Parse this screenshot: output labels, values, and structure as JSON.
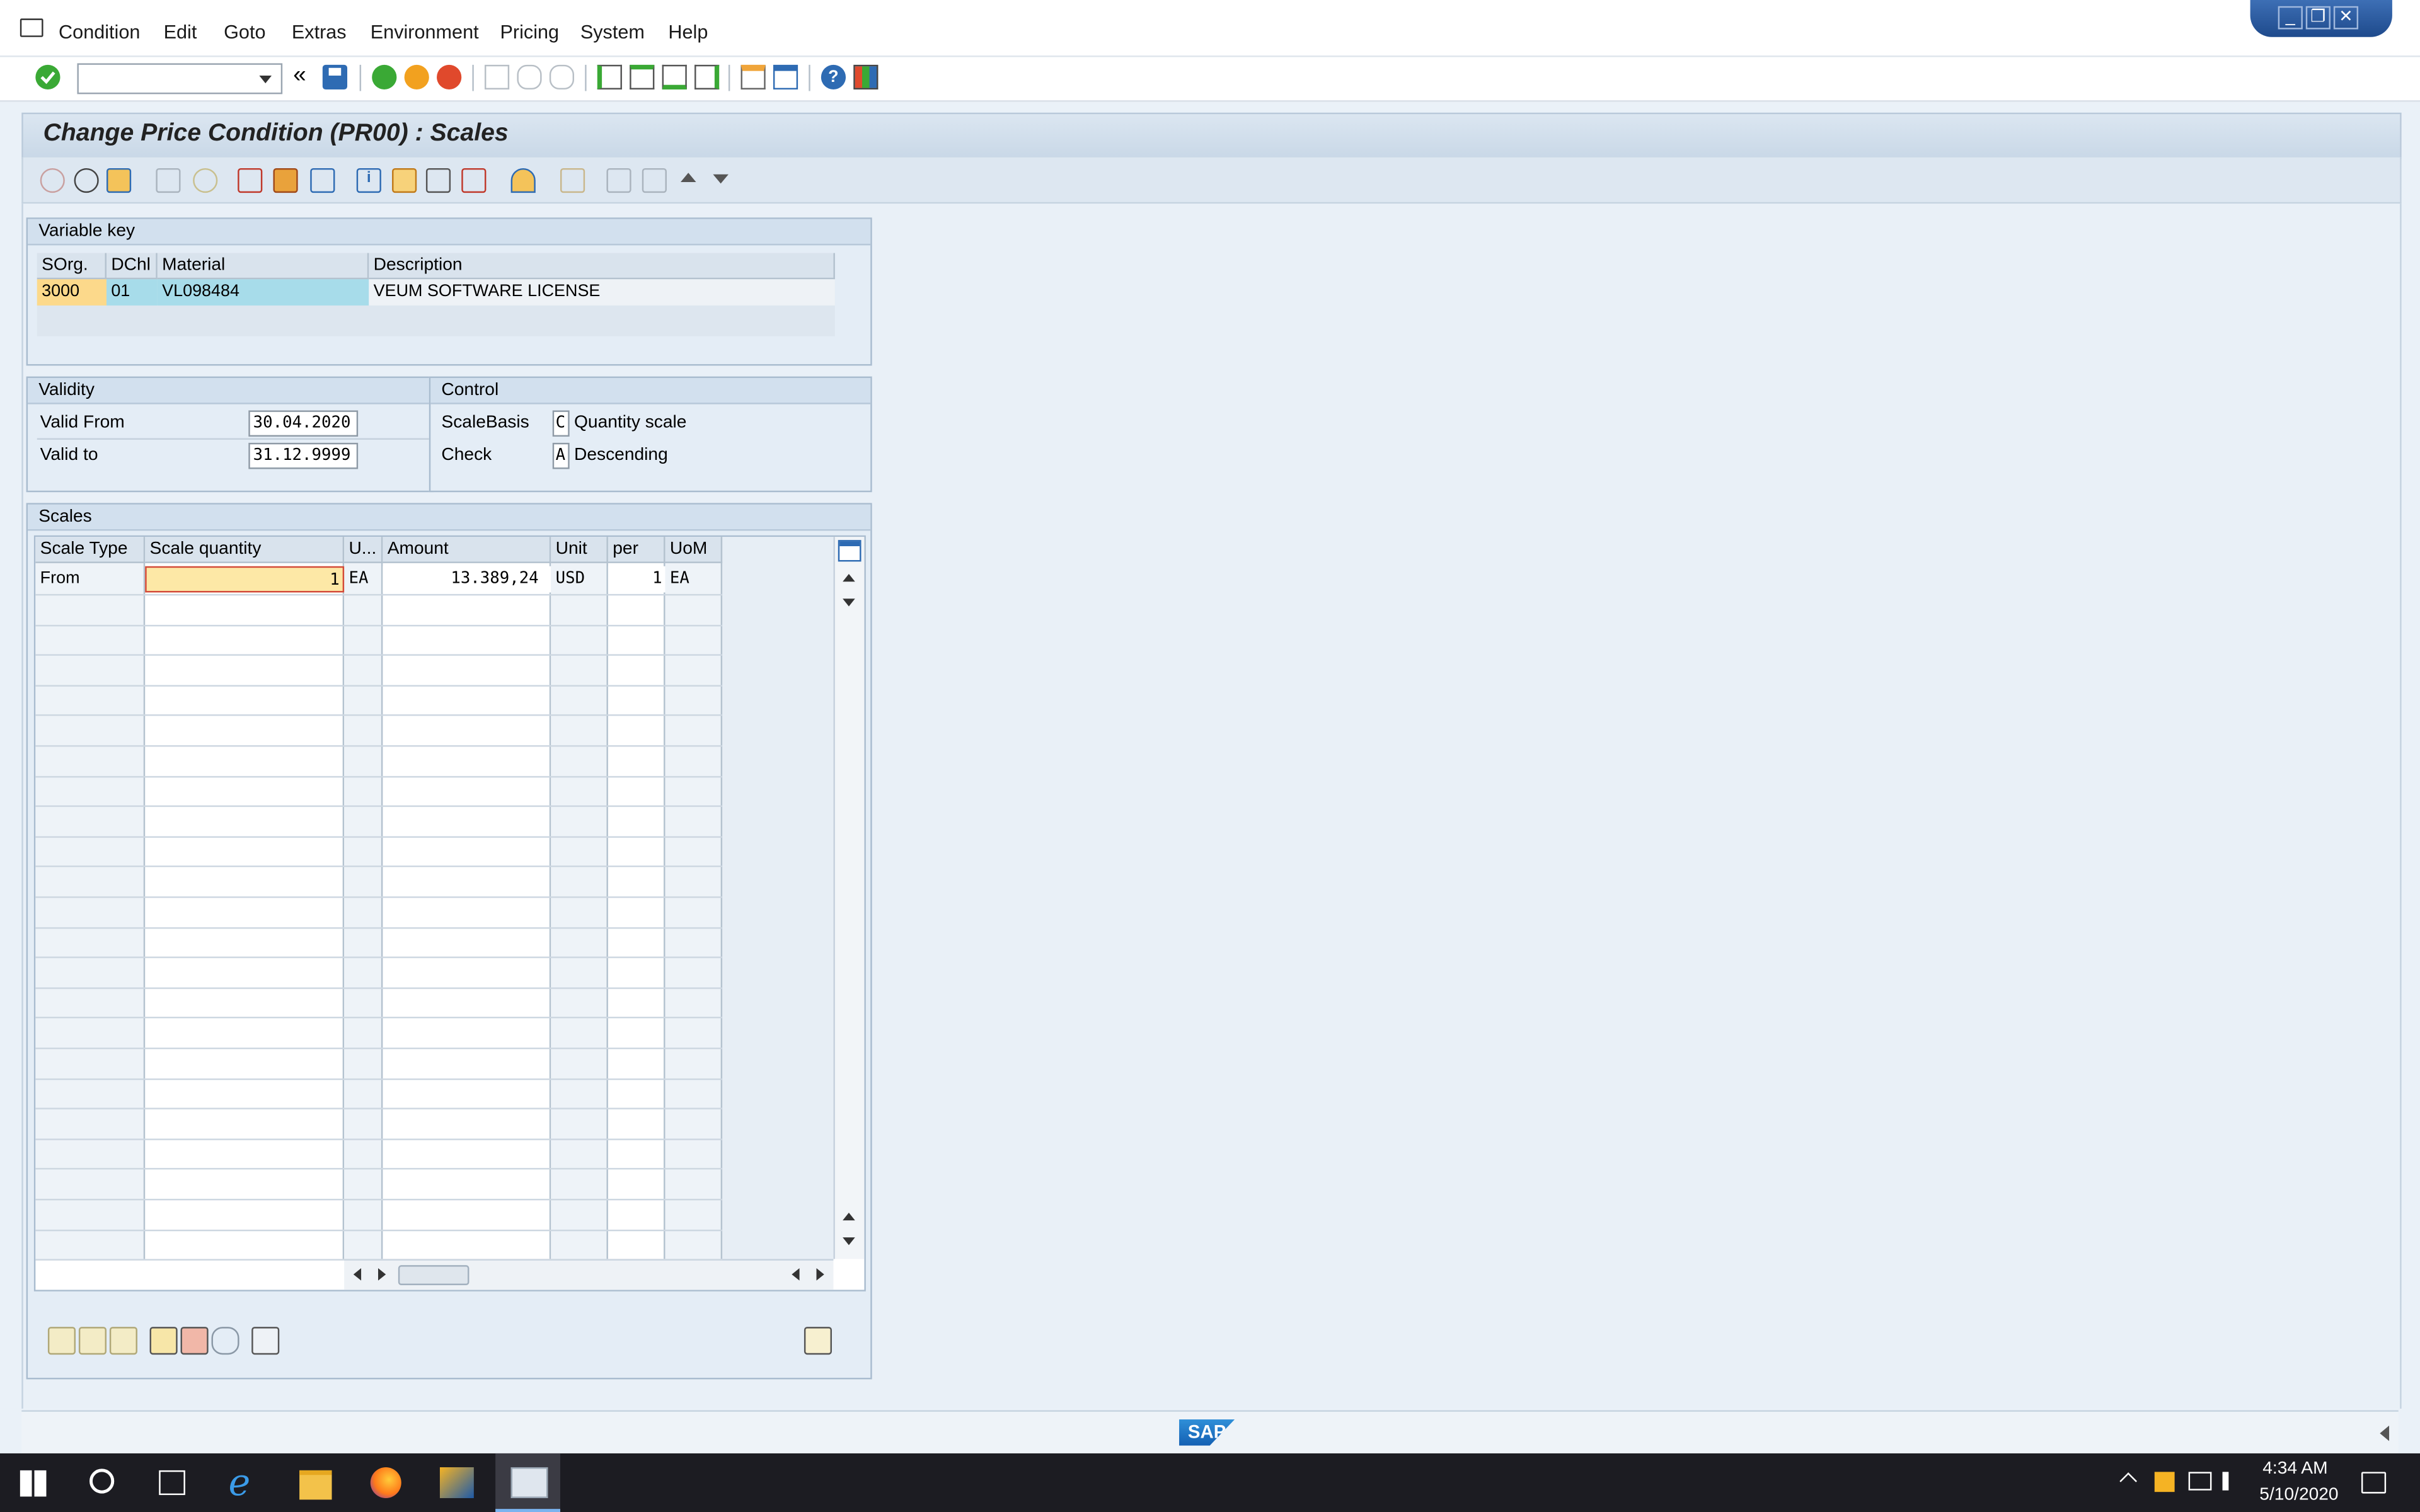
{
  "menu": [
    "Condition",
    "Edit",
    "Goto",
    "Extras",
    "Environment",
    "Pricing",
    "System",
    "Help"
  ],
  "page": {
    "title": "Change Price Condition (PR00) : Scales"
  },
  "variable_key": {
    "title": "Variable key",
    "headers": [
      "SOrg.",
      "DChl",
      "Material",
      "Description"
    ],
    "row": [
      "3000",
      "01",
      "VL098484",
      "VEUM SOFTWARE LICENSE"
    ]
  },
  "validity": {
    "title": "Validity",
    "valid_from_label": "Valid From",
    "valid_from": "30.04.2020",
    "valid_to_label": "Valid to",
    "valid_to": "31.12.9999"
  },
  "control": {
    "title": "Control",
    "scale_basis_label": "ScaleBasis",
    "scale_basis_code": "C",
    "scale_basis_text": "Quantity scale",
    "check_label": "Check",
    "check_code": "A",
    "check_text": "Descending"
  },
  "scales": {
    "title": "Scales",
    "headers": [
      "Scale Type",
      "Scale quantity",
      "U...",
      "Amount",
      "Unit",
      "per",
      "UoM"
    ],
    "row": [
      "From",
      "1",
      "EA",
      "13.389,24",
      "USD",
      "1",
      "EA"
    ]
  },
  "status": {
    "logo": "SAP"
  },
  "taskbar": {
    "time": "4:34 AM",
    "date": "5/10/2020"
  },
  "colors": {
    "accent": "#3a6fb0",
    "key_yellow": "#fcd98b",
    "key_blue": "#a7dcea"
  }
}
